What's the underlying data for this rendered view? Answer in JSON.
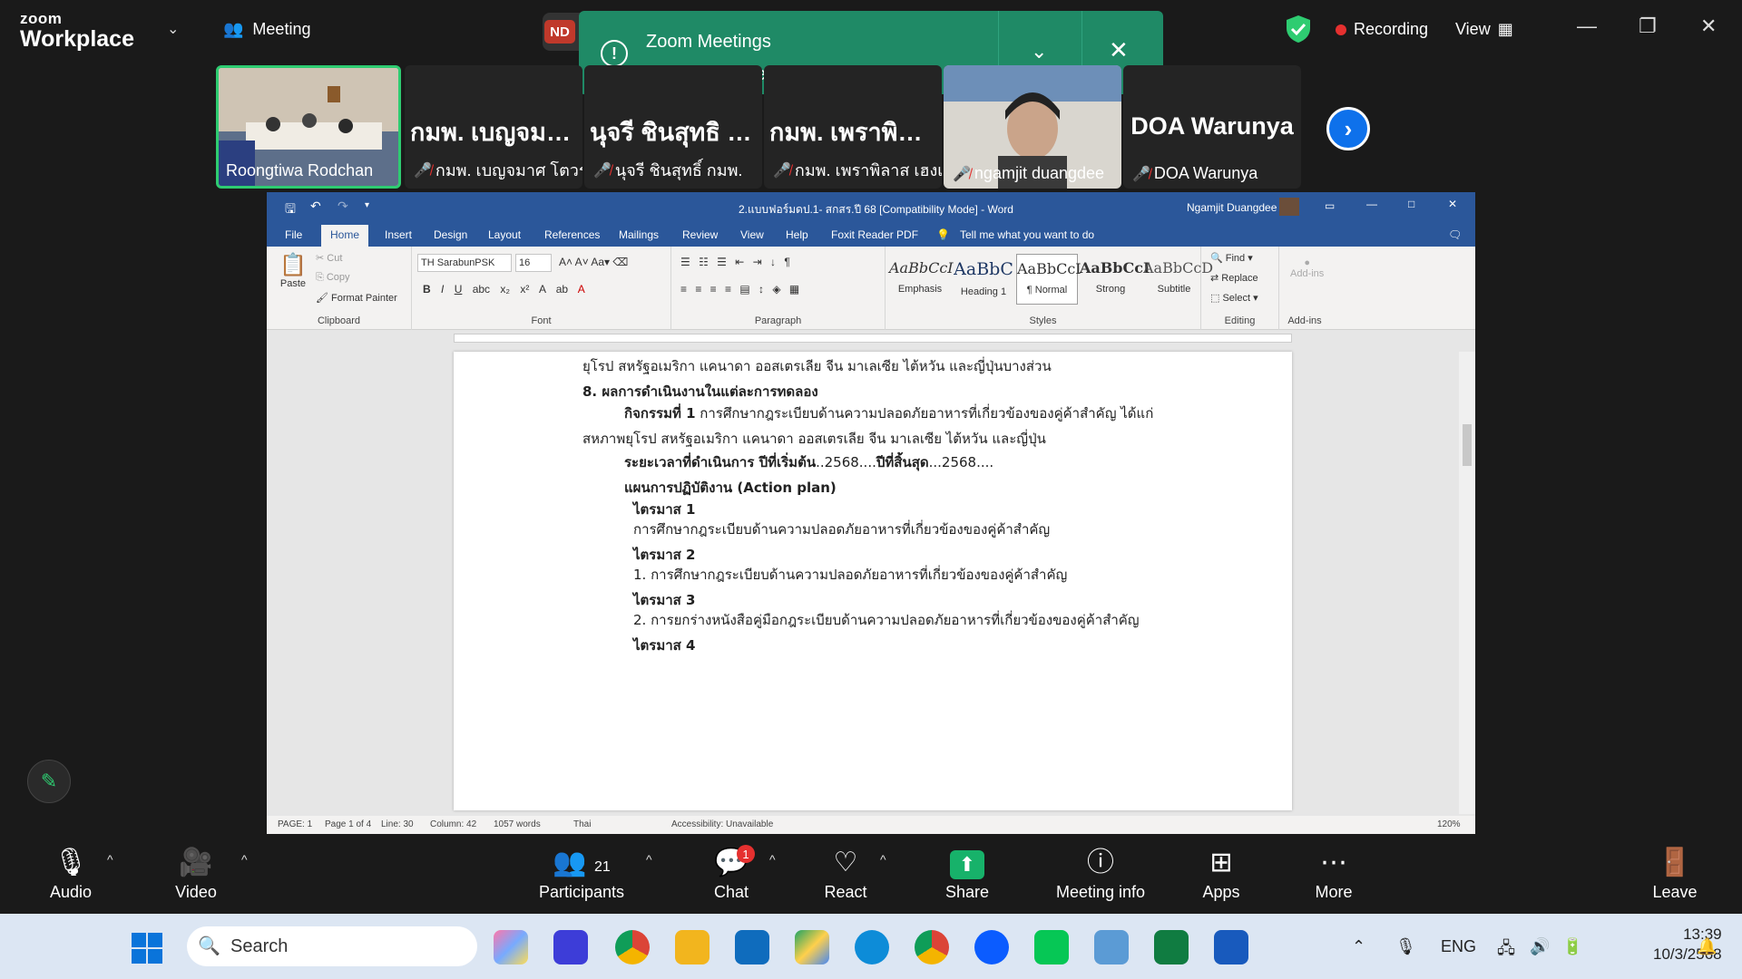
{
  "app": {
    "line1": "zoom",
    "line2": "Workplace",
    "meeting_tab": "Meeting",
    "nd": "ND"
  },
  "toast": {
    "line1": "Zoom Meetings",
    "line2": "is using the webcam and mic"
  },
  "status": {
    "recording": "Recording",
    "view": "View"
  },
  "participants": [
    {
      "display": "",
      "name": "Roongtiwa Rodchan"
    },
    {
      "display": "กมพ. เบญจมาศ โ...",
      "name": "กมพ. เบญจมาศ โตวรานนท์"
    },
    {
      "display": "นุจรี ชินสุทธิ กมพ.",
      "name": "นุจรี ชินสุทธิ์ กมพ."
    },
    {
      "display": "กมพ. เพราพิลาส...",
      "name": "กมพ. เพราพิลาส เฮงเจริญ"
    },
    {
      "display": "",
      "name": "ngamjit duangdee"
    },
    {
      "display": "DOA Warunya",
      "name": "DOA Warunya"
    }
  ],
  "word": {
    "title": "2.แบบฟอร์มดป.1- สกสร.ปี 68  [Compatibility Mode]  -  Word",
    "user": "Ngamjit Duangdee",
    "tabs": [
      "File",
      "Home",
      "Insert",
      "Design",
      "Layout",
      "References",
      "Mailings",
      "Review",
      "View",
      "Help",
      "Foxit Reader PDF"
    ],
    "tell": "Tell me what you want to do",
    "clipboard": {
      "paste": "Paste",
      "cut": "Cut",
      "copy": "Copy",
      "painter": "Format Painter",
      "label": "Clipboard"
    },
    "font": {
      "name": "TH SarabunPSK",
      "size": "16",
      "label": "Font"
    },
    "paragraph_label": "Paragraph",
    "styles": [
      {
        "preview": "AaBbCcI",
        "name": "Emphasis"
      },
      {
        "preview": "AaBbC",
        "name": "Heading 1"
      },
      {
        "preview": "AaBbCcI",
        "name": "¶ Normal"
      },
      {
        "preview": "AaBbCcI",
        "name": "Strong"
      },
      {
        "preview": "AaBbCcD",
        "name": "Subtitle"
      }
    ],
    "styles_label": "Styles",
    "editing": {
      "find": "Find",
      "replace": "Replace",
      "select": "Select",
      "label": "Editing"
    },
    "addins": {
      "label1": "Add-ins",
      "label2": "Add-ins"
    },
    "doc": {
      "l0": "ยุโรป สหรัฐอเมริกา แคนาดา ออสเตรเลีย จีน มาเลเซีย ไต้หวัน และญี่ปุ่นบางส่วน",
      "l1": "8.  ผลการดำเนินงานในแต่ละการทดลอง",
      "l2a": "กิจกรรมที่ 1",
      "l2b": " การศึกษากฎระเบียบด้านความปลอดภัยอาหารที่เกี่ยวข้องของคู่ค้าสำคัญ ได้แก่",
      "l3": "สหภาพยุโรป สหรัฐอเมริกา แคนาดา ออสเตรเลีย จีน มาเลเซีย ไต้หวัน และญี่ปุ่น",
      "l4a": "ระยะเวลาที่ดำเนินการ ปีที่เริ่มต้น",
      "l4b": "..2568....",
      "l4c": "ปีที่สิ้นสุด",
      "l4d": "...2568....",
      "l5": "แผนการปฏิบัติงาน (Action plan)",
      "q1": "ไตรมาส 1",
      "q1t": "การศึกษากฎระเบียบด้านความปลอดภัยอาหารที่เกี่ยวข้องของคู่ค้าสำคัญ",
      "q2": "ไตรมาส 2",
      "q2t": "1.    การศึกษากฎระเบียบด้านความปลอดภัยอาหารที่เกี่ยวข้องของคู่ค้าสำคัญ",
      "q3": "ไตรมาส 3",
      "q3t": "2.    การยกร่างหนังสือคู่มือกฎระเบียบด้านความปลอดภัยอาหารที่เกี่ยวข้องของคู่ค้าสำคัญ",
      "q4": "ไตรมาส 4"
    },
    "statusbar": {
      "page": "PAGE: 1",
      "of": "Page 1 of 4",
      "line": "Line: 30",
      "col": "Column: 42",
      "words": "1057 words",
      "lang": "Thai",
      "access": "Accessibility: Unavailable",
      "zoom": "120%"
    }
  },
  "controls": {
    "audio": "Audio",
    "video": "Video",
    "participants": "Participants",
    "part_count": "21",
    "chat": "Chat",
    "chat_badge": "1",
    "react": "React",
    "share": "Share",
    "info": "Meeting info",
    "apps": "Apps",
    "more": "More",
    "leave": "Leave"
  },
  "taskbar": {
    "search": "Search",
    "lang": "ENG",
    "time": "13:39",
    "date": "10/3/2568"
  }
}
